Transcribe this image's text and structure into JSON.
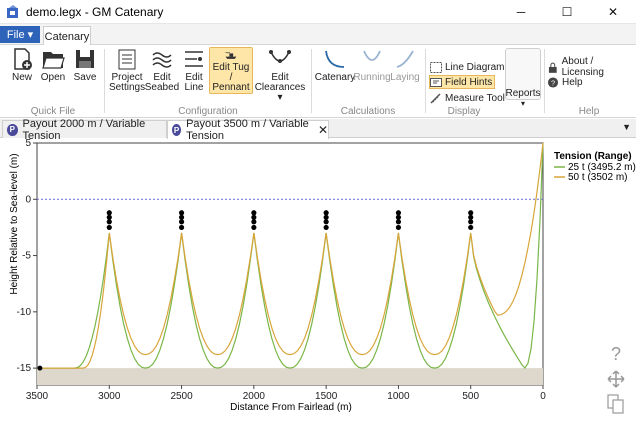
{
  "window": {
    "title": "demo.legx - GM Catenary",
    "minimize": "─",
    "maximize": "☐",
    "close": "✕"
  },
  "ribbon": {
    "file_tab": "File ▾",
    "active_tab": "Catenary",
    "quick_file": {
      "label": "Quick File",
      "new": "New",
      "open": "Open",
      "save": "Save"
    },
    "configuration": {
      "label": "Configuration",
      "project_settings": [
        "Project",
        "Settings"
      ],
      "edit_seabed": [
        "Edit",
        "Seabed"
      ],
      "edit_line": [
        "Edit",
        "Line"
      ],
      "edit_tug": [
        "Edit Tug /",
        "Pennant"
      ],
      "edit_clearances": [
        "Edit",
        "Clearances ▾"
      ]
    },
    "calculations": {
      "label": "Calculations",
      "catenary": "Catenary",
      "running": "Running",
      "laying": "Laying"
    },
    "display": {
      "label": "Display",
      "line_diagram": "Line Diagram",
      "field_hints": "Field Hints",
      "measure_tool": "Measure Tool"
    },
    "reports": {
      "label": "Reports",
      "arrow": "▾"
    },
    "help": {
      "label": "Help",
      "about": "About / Licensing",
      "help": "Help"
    }
  },
  "tabs": [
    {
      "label": "Payout 2000 m / Variable Tension",
      "active": false
    },
    {
      "label": "Payout 3500 m / Variable Tension",
      "active": true,
      "close": "✕"
    }
  ],
  "tab_menu": "▼",
  "side_icons": {
    "help": "help-icon",
    "move": "move-icon",
    "copy": "copy-icon"
  },
  "chart_data": {
    "type": "line",
    "xlabel": "Distance From Fairlead (m)",
    "ylabel": "Height Relative to Sea-level (m)",
    "xlim": [
      3500,
      0
    ],
    "ylim": [
      -16.5,
      5
    ],
    "x_ticks": [
      "3500",
      "3000",
      "2500",
      "2000",
      "1500",
      "1000",
      "500",
      "0"
    ],
    "y_ticks": [
      "5",
      "0",
      "-5",
      "-10",
      "-15"
    ],
    "seabed": -15,
    "sea_level": 0,
    "buoy_positions": [
      3000,
      2500,
      2000,
      1500,
      1000,
      500
    ],
    "legend": {
      "title": "Tension (Range)",
      "placement": "top-right"
    },
    "series": [
      {
        "name": "25 t (3495.2 m)",
        "color": "#7ab648",
        "trough": -15
      },
      {
        "name": "50 t (3502 m)",
        "color": "#d9a53a",
        "trough": -13.8
      }
    ]
  }
}
